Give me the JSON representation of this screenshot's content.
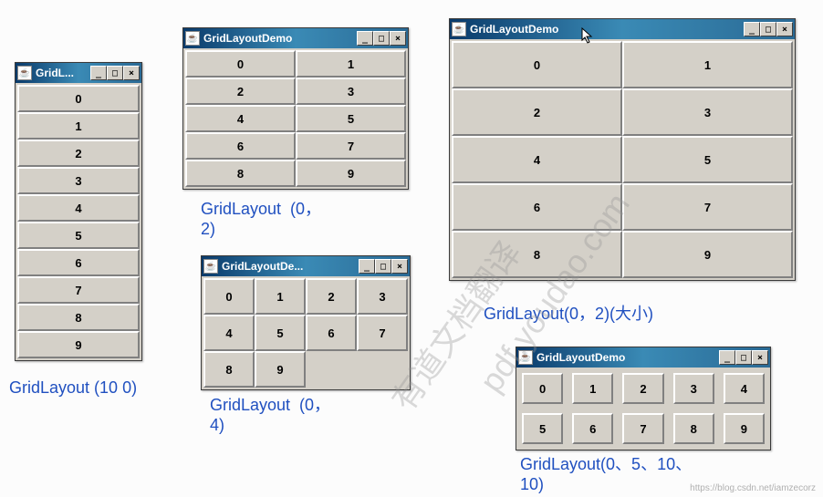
{
  "windows": {
    "w1": {
      "title": "GridL...",
      "cells": [
        "0",
        "1",
        "2",
        "3",
        "4",
        "5",
        "6",
        "7",
        "8",
        "9"
      ]
    },
    "w2": {
      "title": "GridLayoutDemo",
      "cells": [
        "0",
        "1",
        "2",
        "3",
        "4",
        "5",
        "6",
        "7",
        "8",
        "9"
      ]
    },
    "w3": {
      "title": "GridLayoutDe...",
      "cells": [
        "0",
        "1",
        "2",
        "3",
        "4",
        "5",
        "6",
        "7",
        "8",
        "9"
      ]
    },
    "w4": {
      "title": "GridLayoutDemo",
      "cells": [
        "0",
        "1",
        "2",
        "3",
        "4",
        "5",
        "6",
        "7",
        "8",
        "9"
      ]
    },
    "w5": {
      "title": "GridLayoutDemo",
      "cells": [
        "0",
        "1",
        "2",
        "3",
        "4",
        "5",
        "6",
        "7",
        "8",
        "9"
      ]
    }
  },
  "captions": {
    "c1": "GridLayout (10 0)",
    "c2": "GridLayout  (0，\n2)",
    "c3": "GridLayout  (0，\n4)",
    "c4": "GridLayout(0，2)(大小)",
    "c5": "GridLayout(0、5、10、\n10)"
  },
  "java_icon_glyph": "☕",
  "win_btn_min": "_",
  "win_btn_max": "□",
  "win_btn_close": "×",
  "watermark1": "有道文档翻译",
  "watermark2": "pdf.youdao.com",
  "attribution": "https://blog.csdn.net/iamzecorz"
}
